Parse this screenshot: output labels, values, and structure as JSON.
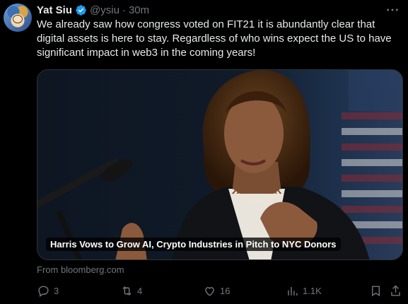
{
  "author": {
    "name": "Yat Siu",
    "handle": "@ysiu",
    "separator": "·",
    "time": "30m"
  },
  "tweet": {
    "text": "We already saw how congress voted on FIT21 it is abundantly clear that digital assets is here to stay. Regardless of who wins expect the US to have significant impact in web3 in the coming years!"
  },
  "card": {
    "headline": "Harris Vows to Grow AI, Crypto Industries in Pitch to NYC Donors",
    "source": "From bloomberg.com"
  },
  "actions": {
    "replies": "3",
    "reposts": "4",
    "likes": "16",
    "views": "1.1K"
  },
  "colors": {
    "background": "#000000",
    "text": "#e7e9ea",
    "muted": "#71767b",
    "verified": "#1d9bf0"
  }
}
